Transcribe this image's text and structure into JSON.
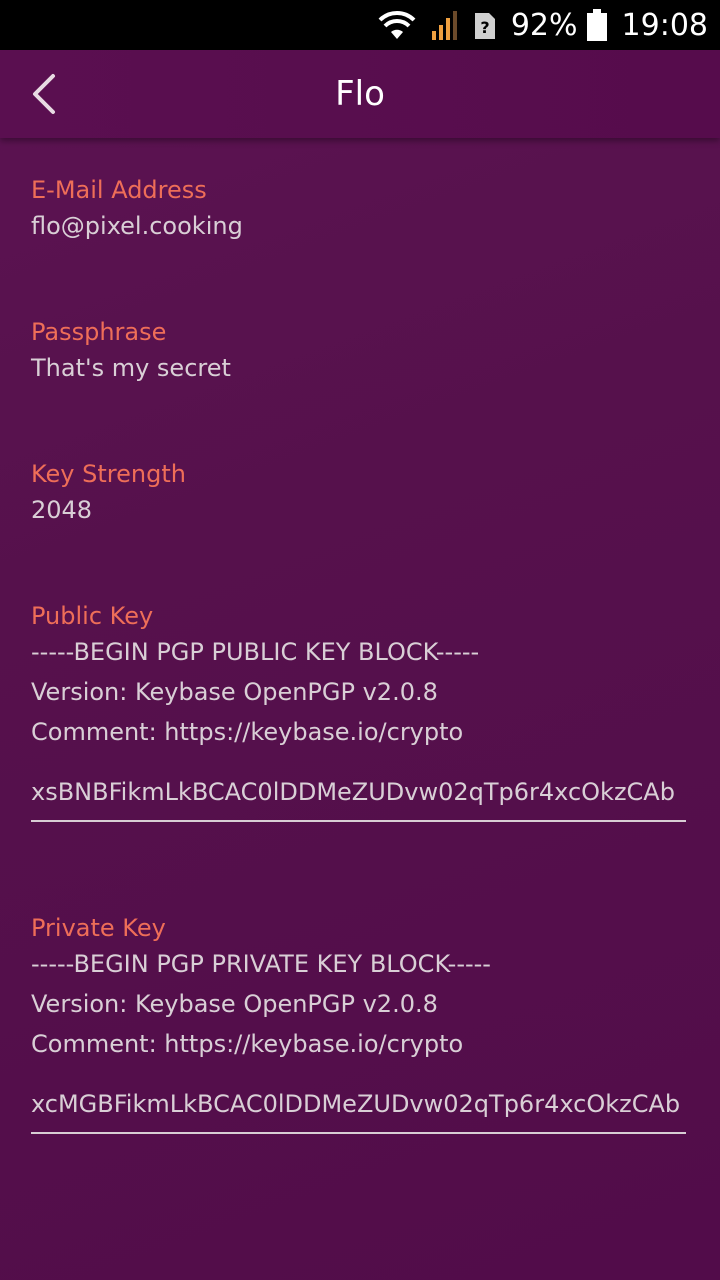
{
  "status_bar": {
    "battery_percent": "92%",
    "time": "19:08",
    "icons": [
      "wifi-icon",
      "signal-icon",
      "sim-unknown-icon",
      "battery-icon"
    ]
  },
  "app_bar": {
    "title": "Flo",
    "back_icon": "chevron-left-icon"
  },
  "fields": {
    "email": {
      "label": "E-Mail Address",
      "value": "flo@pixel.cooking"
    },
    "passphrase": {
      "label": "Passphrase",
      "value": "That's my secret"
    },
    "key_strength": {
      "label": "Key Strength",
      "value": "2048"
    },
    "public_key": {
      "label": "Public Key",
      "lines": [
        "-----BEGIN PGP PUBLIC KEY BLOCK-----",
        "Version: Keybase OpenPGP v2.0.8",
        "Comment: https://keybase.io/crypto"
      ],
      "key_line": "xsBNBFikmLkBCAC0lDDMeZUDvw02qTp6r4xcOkzCAb"
    },
    "private_key": {
      "label": "Private Key",
      "lines": [
        "-----BEGIN PGP PRIVATE KEY BLOCK-----",
        "Version: Keybase OpenPGP v2.0.8",
        "Comment: https://keybase.io/crypto"
      ],
      "key_line": "xcMGBFikmLkBCAC0lDDMeZUDvw02qTp6r4xcOkzCAb"
    }
  },
  "colors": {
    "label": "#ee6e58",
    "text": "#d9cfd6",
    "background": "#56114c"
  }
}
